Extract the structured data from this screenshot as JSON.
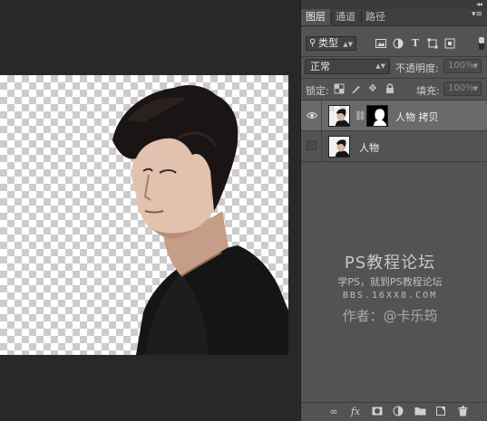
{
  "panel": {
    "tabs": [
      {
        "label": "图层",
        "active": true
      },
      {
        "label": "通道",
        "active": false
      },
      {
        "label": "路径",
        "active": false
      }
    ],
    "filter": {
      "kind_label": "类型",
      "toggle_on": true
    },
    "blend_mode": "正常",
    "opacity": {
      "label": "不透明度:",
      "value": "100%"
    },
    "lock_label": "锁定:",
    "fill": {
      "label": "填充:",
      "value": "100%"
    },
    "layers": [
      {
        "name": "人物 拷贝",
        "visible": true,
        "selected": true,
        "has_mask": true
      },
      {
        "name": "人物",
        "visible": false,
        "selected": false,
        "has_mask": false
      }
    ]
  },
  "watermark": {
    "title": "PS教程论坛",
    "subtitle": "学PS，就到PS教程论坛",
    "url": "BBS.16XX8.COM",
    "author": "作者：@卡乐筠"
  },
  "icons": {
    "collapse": "double-chevron-icon",
    "panel_menu": "panel-menu-icon",
    "filter": [
      "image-filter-icon",
      "adjustment-filter-icon",
      "type-filter-icon",
      "shape-filter-icon",
      "smart-object-filter-icon"
    ],
    "lock": [
      "lock-transparent-icon",
      "lock-image-icon",
      "lock-position-icon",
      "lock-all-icon"
    ],
    "bottom": [
      "link-layers-icon",
      "fx-icon",
      "add-mask-icon",
      "adjustment-layer-icon",
      "new-group-icon",
      "new-layer-icon",
      "delete-icon"
    ]
  },
  "colors": {
    "panel_bg": "#535353",
    "selected_layer": "#6a6a6a",
    "workspace_bg": "#282828"
  }
}
